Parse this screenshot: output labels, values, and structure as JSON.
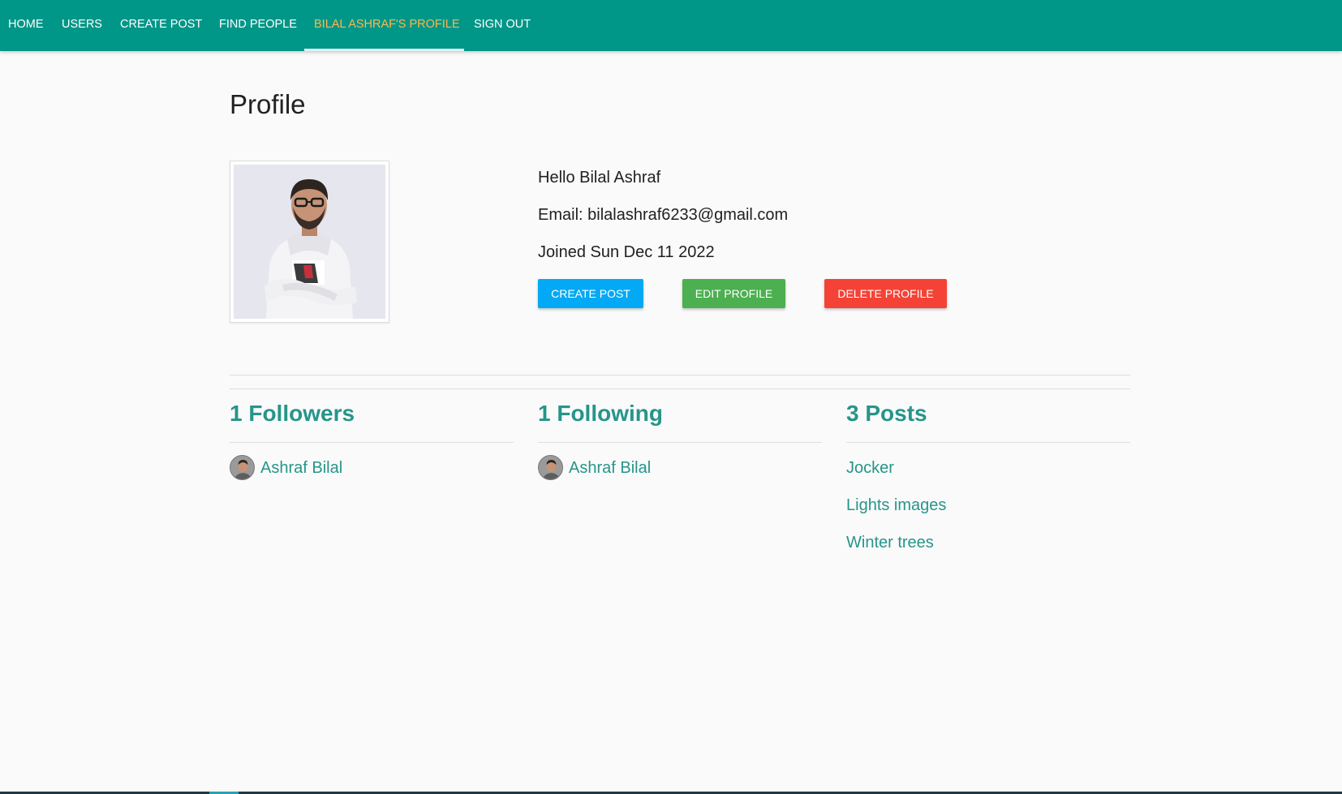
{
  "nav": {
    "home": "HOME",
    "users": "USERS",
    "create_post": "CREATE POST",
    "find_people": "FIND PEOPLE",
    "profile": "BILAL ASHRAF'S PROFILE",
    "sign_out": "SIGN OUT"
  },
  "page": {
    "title": "Profile"
  },
  "profile": {
    "greeting": "Hello Bilal Ashraf",
    "email": "Email: bilalashraf6233@gmail.com",
    "joined": "Joined Sun Dec 11 2022",
    "buttons": {
      "create_post": "CREATE POST",
      "edit_profile": "EDIT PROFILE",
      "delete_profile": "DELETE PROFILE"
    }
  },
  "followers": {
    "title": "1 Followers",
    "items": [
      {
        "name": "Ashraf Bilal"
      }
    ]
  },
  "following": {
    "title": "1 Following",
    "items": [
      {
        "name": "Ashraf Bilal"
      }
    ]
  },
  "posts": {
    "title": "3 Posts",
    "items": [
      {
        "title": "Jocker"
      },
      {
        "title": "Lights images"
      },
      {
        "title": "Winter trees"
      }
    ]
  },
  "colors": {
    "navbar": "#009688",
    "active_nav": "#ffb74d",
    "link": "#26958a",
    "create_button": "#03a9f4",
    "edit_button": "#4caf50",
    "delete_button": "#f44336"
  }
}
